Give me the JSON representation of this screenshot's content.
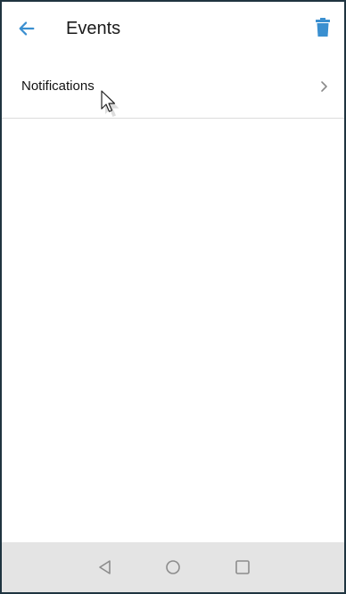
{
  "app_bar": {
    "title": "Events",
    "back_icon": "arrow-left-icon",
    "delete_icon": "trash-icon",
    "accent_color": "#3a8fd0"
  },
  "list": {
    "items": [
      {
        "label": "Notifications",
        "icon": "chevron-right-icon"
      }
    ]
  },
  "system_nav": {
    "back_icon": "nav-back-triangle-icon",
    "home_icon": "nav-home-circle-icon",
    "recents_icon": "nav-recents-square-icon"
  }
}
